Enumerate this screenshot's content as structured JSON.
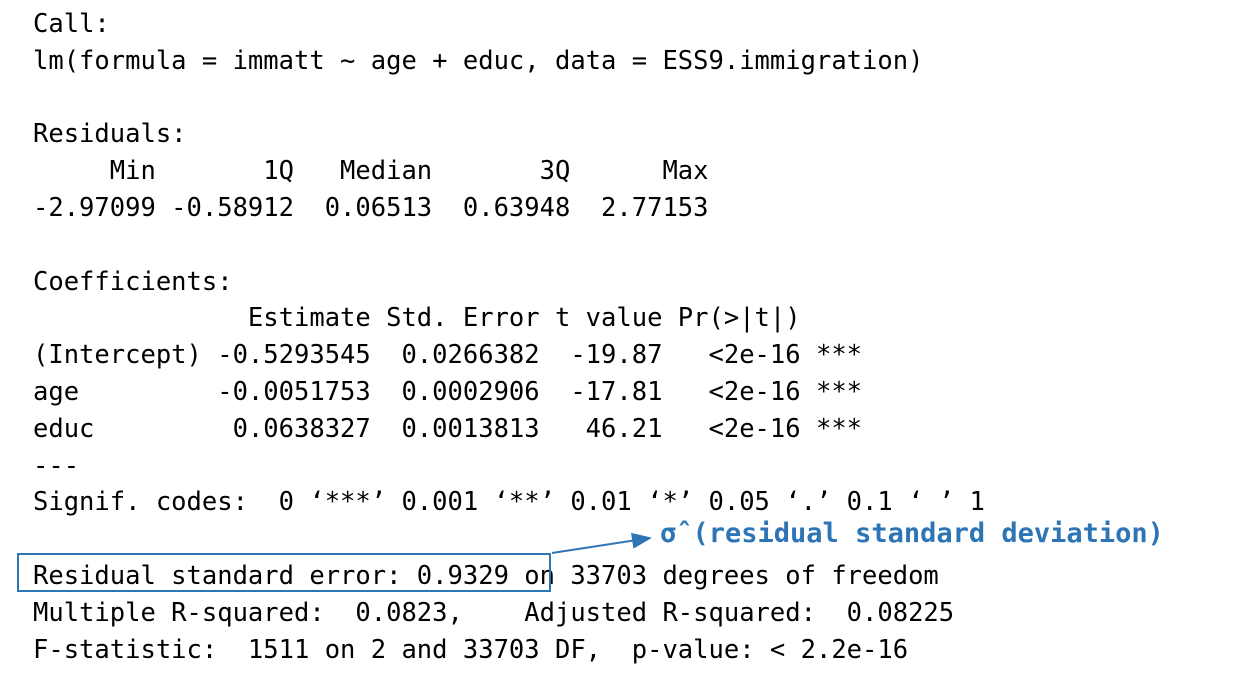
{
  "regression_output": {
    "call_header": "Call:",
    "call_formula": "lm(formula = immatt ~ age + educ, data = ESS9.immigration)",
    "residuals_header": "Residuals:",
    "residuals_labels": "     Min       1Q   Median       3Q      Max ",
    "residuals_values": "-2.97099 -0.58912  0.06513  0.63948  2.77153 ",
    "coefficients_header": "Coefficients:",
    "coefficients_columns": "              Estimate Std. Error t value Pr(>|t|)    ",
    "coefficients_rows": [
      "(Intercept) -0.5293545  0.0266382  -19.87   <2e-16 ***",
      "age         -0.0051753  0.0002906  -17.81   <2e-16 ***",
      "educ         0.0638327  0.0013813   46.21   <2e-16 ***"
    ],
    "separator": "---",
    "signif_codes": "Signif. codes:  0 ‘***’ 0.001 ‘**’ 0.01 ‘*’ 0.05 ‘.’ 0.1 ‘ ’ 1",
    "residual_se_line": "Residual standard error: 0.9329 on 33703 degrees of freedom",
    "r_squared_line": "Multiple R-squared:  0.0823,    Adjusted R-squared:  0.08225 ",
    "f_statistic_line": "F-statistic:  1511 on 2 and 33703 DF,  p-value: < 2.2e-16"
  },
  "annotation": {
    "label": "σ̂ (residual standard deviation)",
    "color": "#2e75b6"
  }
}
